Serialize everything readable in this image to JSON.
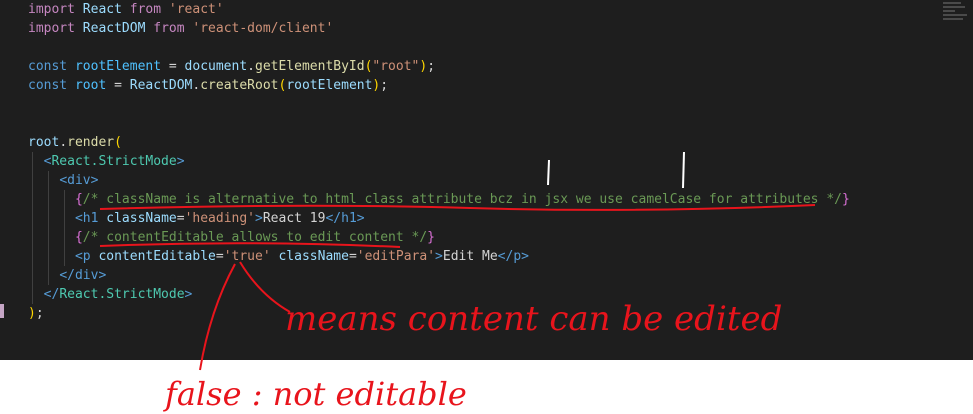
{
  "code": {
    "lines": [
      [
        {
          "c": "kw",
          "t": "import"
        },
        {
          "c": "plain",
          "t": " "
        },
        {
          "c": "id",
          "t": "React"
        },
        {
          "c": "plain",
          "t": " "
        },
        {
          "c": "kw",
          "t": "from"
        },
        {
          "c": "plain",
          "t": " "
        },
        {
          "c": "str",
          "t": "'react'"
        }
      ],
      [
        {
          "c": "kw",
          "t": "import"
        },
        {
          "c": "plain",
          "t": " "
        },
        {
          "c": "id",
          "t": "ReactDOM"
        },
        {
          "c": "plain",
          "t": " "
        },
        {
          "c": "kw",
          "t": "from"
        },
        {
          "c": "plain",
          "t": " "
        },
        {
          "c": "str",
          "t": "'react-dom/client'"
        }
      ],
      [],
      [
        {
          "c": "kwb",
          "t": "const"
        },
        {
          "c": "plain",
          "t": " "
        },
        {
          "c": "var",
          "t": "rootElement"
        },
        {
          "c": "plain",
          "t": " = "
        },
        {
          "c": "id",
          "t": "document"
        },
        {
          "c": "plain",
          "t": "."
        },
        {
          "c": "fn",
          "t": "getElementById"
        },
        {
          "c": "br1",
          "t": "("
        },
        {
          "c": "str",
          "t": "\"root\""
        },
        {
          "c": "br1",
          "t": ")"
        },
        {
          "c": "plain",
          "t": ";"
        }
      ],
      [
        {
          "c": "kwb",
          "t": "const"
        },
        {
          "c": "plain",
          "t": " "
        },
        {
          "c": "var",
          "t": "root"
        },
        {
          "c": "plain",
          "t": " = "
        },
        {
          "c": "id",
          "t": "ReactDOM"
        },
        {
          "c": "plain",
          "t": "."
        },
        {
          "c": "fn",
          "t": "createRoot"
        },
        {
          "c": "br1",
          "t": "("
        },
        {
          "c": "id",
          "t": "rootElement"
        },
        {
          "c": "br1",
          "t": ")"
        },
        {
          "c": "plain",
          "t": ";"
        }
      ],
      [],
      [],
      [
        {
          "c": "id",
          "t": "root"
        },
        {
          "c": "plain",
          "t": "."
        },
        {
          "c": "fn",
          "t": "render"
        },
        {
          "c": "br1",
          "t": "("
        }
      ],
      [
        {
          "c": "plain",
          "t": "  "
        },
        {
          "c": "tag",
          "t": "<"
        },
        {
          "c": "tagn",
          "t": "React.StrictMode"
        },
        {
          "c": "tag",
          "t": ">"
        }
      ],
      [
        {
          "c": "plain",
          "t": "    "
        },
        {
          "c": "tag",
          "t": "<"
        },
        {
          "c": "tag",
          "t": "div"
        },
        {
          "c": "tag",
          "t": ">"
        }
      ],
      [
        {
          "c": "plain",
          "t": "      "
        },
        {
          "c": "br2",
          "t": "{"
        },
        {
          "c": "cm",
          "t": "/* className is alternative to html class attribute bcz in jsx we use camelCase for attributes */"
        },
        {
          "c": "br2",
          "t": "}"
        }
      ],
      [
        {
          "c": "plain",
          "t": "      "
        },
        {
          "c": "tag",
          "t": "<"
        },
        {
          "c": "tag",
          "t": "h1"
        },
        {
          "c": "plain",
          "t": " "
        },
        {
          "c": "attr",
          "t": "className"
        },
        {
          "c": "plain",
          "t": "="
        },
        {
          "c": "str",
          "t": "'heading'"
        },
        {
          "c": "tag",
          "t": ">"
        },
        {
          "c": "plain",
          "t": "React 19"
        },
        {
          "c": "tag",
          "t": "</"
        },
        {
          "c": "tag",
          "t": "h1"
        },
        {
          "c": "tag",
          "t": ">"
        }
      ],
      [
        {
          "c": "plain",
          "t": "      "
        },
        {
          "c": "br2",
          "t": "{"
        },
        {
          "c": "cm",
          "t": "/* contentEditable allows to edit content */"
        },
        {
          "c": "br2",
          "t": "}"
        }
      ],
      [
        {
          "c": "plain",
          "t": "      "
        },
        {
          "c": "tag",
          "t": "<"
        },
        {
          "c": "tag",
          "t": "p"
        },
        {
          "c": "plain",
          "t": " "
        },
        {
          "c": "attr",
          "t": "contentEditable"
        },
        {
          "c": "plain",
          "t": "="
        },
        {
          "c": "str",
          "t": "'true'"
        },
        {
          "c": "plain",
          "t": " "
        },
        {
          "c": "attr",
          "t": "className"
        },
        {
          "c": "plain",
          "t": "="
        },
        {
          "c": "str",
          "t": "'editPara'"
        },
        {
          "c": "tag",
          "t": ">"
        },
        {
          "c": "plain",
          "t": "Edit Me"
        },
        {
          "c": "tag",
          "t": "</"
        },
        {
          "c": "tag",
          "t": "p"
        },
        {
          "c": "tag",
          "t": ">"
        }
      ],
      [
        {
          "c": "plain",
          "t": "    "
        },
        {
          "c": "tag",
          "t": "</"
        },
        {
          "c": "tag",
          "t": "div"
        },
        {
          "c": "tag",
          "t": ">"
        }
      ],
      [
        {
          "c": "plain",
          "t": "  "
        },
        {
          "c": "tag",
          "t": "</"
        },
        {
          "c": "tagn",
          "t": "React.StrictMode"
        },
        {
          "c": "tag",
          "t": ">"
        }
      ],
      [
        {
          "c": "br1",
          "t": ")"
        },
        {
          "c": "plain",
          "t": ";"
        }
      ]
    ]
  },
  "annotations": {
    "note_1": "means content can be edited",
    "note_2": "false : not editable"
  },
  "colors": {
    "editor_bg": "#1e1e1e",
    "annotation_ink": "#e8141c"
  }
}
